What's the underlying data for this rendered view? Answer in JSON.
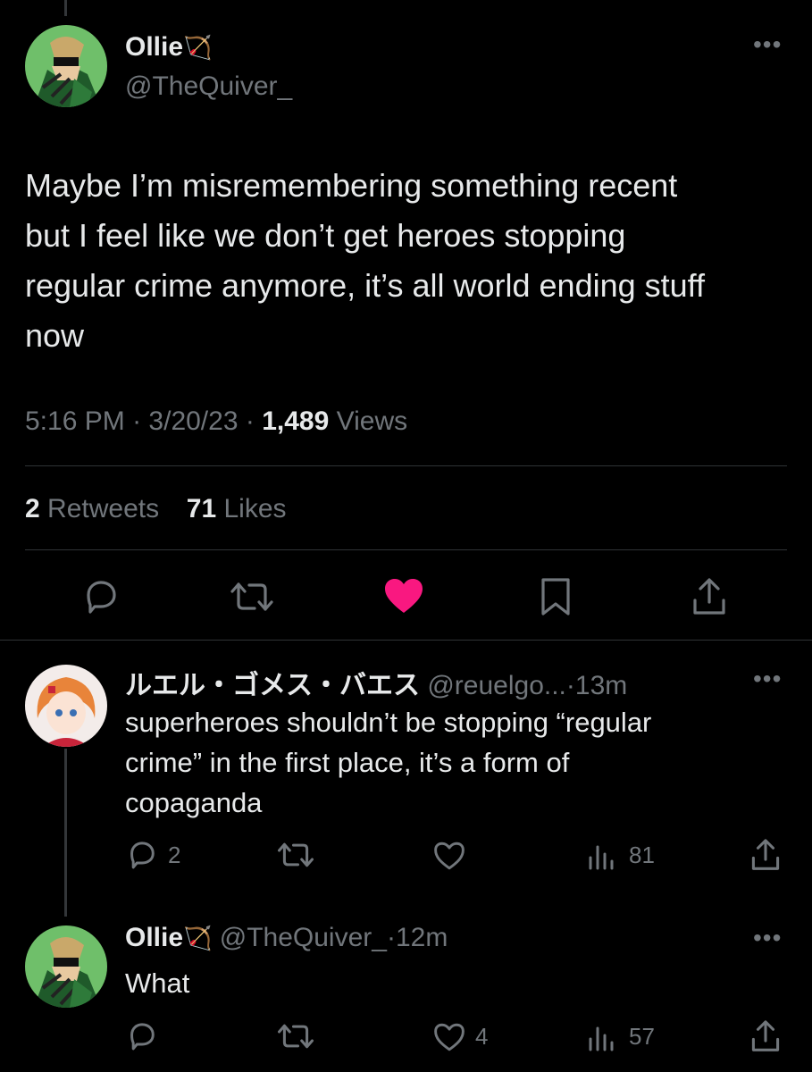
{
  "main_tweet": {
    "display_name": "Ollie",
    "name_emoji": "🏹",
    "handle": "@TheQuiver_",
    "text_lines": [
      "Maybe I’m misremembering something recent",
      "but I feel like we don’t get heroes stopping",
      "regular crime anymore, it’s all world ending stuff",
      "now"
    ],
    "time": "5:16 PM",
    "sep": "·",
    "date": "3/20/23",
    "views_count": "1,489",
    "views_label": "Views",
    "retweets_count": "2",
    "retweets_label": "Retweets",
    "likes_count": "71",
    "likes_label": "Likes"
  },
  "replies": [
    {
      "display_name": "ルエル・ゴメス・バエス",
      "handle": "@reuelgo...",
      "sep": "·",
      "time": "13m",
      "text_lines": [
        "superheroes shouldn’t be stopping “regular",
        "crime” in the first place, it’s a form of",
        "copaganda"
      ],
      "reply_count": "2",
      "retweet_count": "",
      "like_count": "",
      "view_count": "81"
    },
    {
      "display_name": "Ollie",
      "name_emoji": "🏹",
      "handle": "@TheQuiver_",
      "sep": "·",
      "time": "12m",
      "text_lines": [
        "What"
      ],
      "reply_count": "",
      "retweet_count": "",
      "like_count": "4",
      "view_count": "57"
    }
  ],
  "colors": {
    "background": "#000000",
    "text": "#e7e9ea",
    "muted": "#71767b",
    "like_active": "#f91880",
    "divider": "#2f3336"
  }
}
